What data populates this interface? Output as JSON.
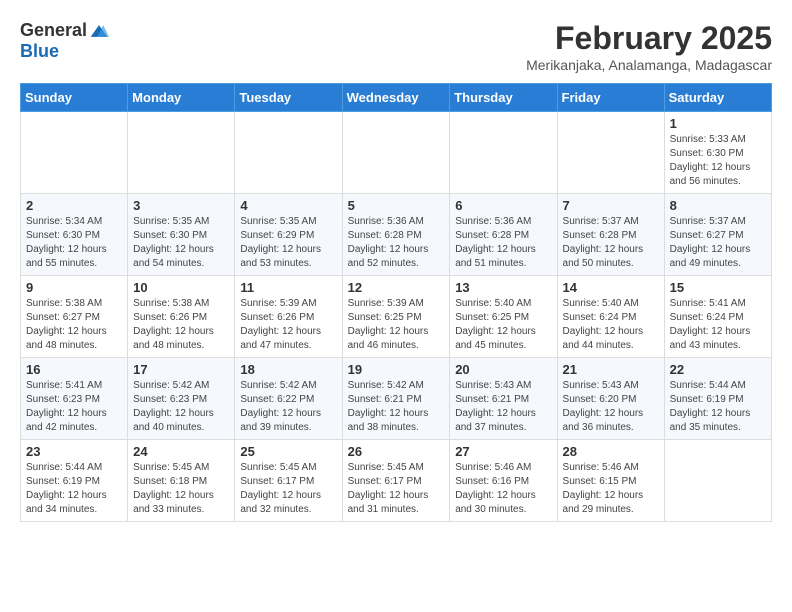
{
  "header": {
    "logo_general": "General",
    "logo_blue": "Blue",
    "month_title": "February 2025",
    "location": "Merikanjaka, Analamanga, Madagascar"
  },
  "weekdays": [
    "Sunday",
    "Monday",
    "Tuesday",
    "Wednesday",
    "Thursday",
    "Friday",
    "Saturday"
  ],
  "weeks": [
    [
      {
        "day": "",
        "info": ""
      },
      {
        "day": "",
        "info": ""
      },
      {
        "day": "",
        "info": ""
      },
      {
        "day": "",
        "info": ""
      },
      {
        "day": "",
        "info": ""
      },
      {
        "day": "",
        "info": ""
      },
      {
        "day": "1",
        "info": "Sunrise: 5:33 AM\nSunset: 6:30 PM\nDaylight: 12 hours and 56 minutes."
      }
    ],
    [
      {
        "day": "2",
        "info": "Sunrise: 5:34 AM\nSunset: 6:30 PM\nDaylight: 12 hours and 55 minutes."
      },
      {
        "day": "3",
        "info": "Sunrise: 5:35 AM\nSunset: 6:30 PM\nDaylight: 12 hours and 54 minutes."
      },
      {
        "day": "4",
        "info": "Sunrise: 5:35 AM\nSunset: 6:29 PM\nDaylight: 12 hours and 53 minutes."
      },
      {
        "day": "5",
        "info": "Sunrise: 5:36 AM\nSunset: 6:28 PM\nDaylight: 12 hours and 52 minutes."
      },
      {
        "day": "6",
        "info": "Sunrise: 5:36 AM\nSunset: 6:28 PM\nDaylight: 12 hours and 51 minutes."
      },
      {
        "day": "7",
        "info": "Sunrise: 5:37 AM\nSunset: 6:28 PM\nDaylight: 12 hours and 50 minutes."
      },
      {
        "day": "8",
        "info": "Sunrise: 5:37 AM\nSunset: 6:27 PM\nDaylight: 12 hours and 49 minutes."
      }
    ],
    [
      {
        "day": "9",
        "info": "Sunrise: 5:38 AM\nSunset: 6:27 PM\nDaylight: 12 hours and 48 minutes."
      },
      {
        "day": "10",
        "info": "Sunrise: 5:38 AM\nSunset: 6:26 PM\nDaylight: 12 hours and 48 minutes."
      },
      {
        "day": "11",
        "info": "Sunrise: 5:39 AM\nSunset: 6:26 PM\nDaylight: 12 hours and 47 minutes."
      },
      {
        "day": "12",
        "info": "Sunrise: 5:39 AM\nSunset: 6:25 PM\nDaylight: 12 hours and 46 minutes."
      },
      {
        "day": "13",
        "info": "Sunrise: 5:40 AM\nSunset: 6:25 PM\nDaylight: 12 hours and 45 minutes."
      },
      {
        "day": "14",
        "info": "Sunrise: 5:40 AM\nSunset: 6:24 PM\nDaylight: 12 hours and 44 minutes."
      },
      {
        "day": "15",
        "info": "Sunrise: 5:41 AM\nSunset: 6:24 PM\nDaylight: 12 hours and 43 minutes."
      }
    ],
    [
      {
        "day": "16",
        "info": "Sunrise: 5:41 AM\nSunset: 6:23 PM\nDaylight: 12 hours and 42 minutes."
      },
      {
        "day": "17",
        "info": "Sunrise: 5:42 AM\nSunset: 6:23 PM\nDaylight: 12 hours and 40 minutes."
      },
      {
        "day": "18",
        "info": "Sunrise: 5:42 AM\nSunset: 6:22 PM\nDaylight: 12 hours and 39 minutes."
      },
      {
        "day": "19",
        "info": "Sunrise: 5:42 AM\nSunset: 6:21 PM\nDaylight: 12 hours and 38 minutes."
      },
      {
        "day": "20",
        "info": "Sunrise: 5:43 AM\nSunset: 6:21 PM\nDaylight: 12 hours and 37 minutes."
      },
      {
        "day": "21",
        "info": "Sunrise: 5:43 AM\nSunset: 6:20 PM\nDaylight: 12 hours and 36 minutes."
      },
      {
        "day": "22",
        "info": "Sunrise: 5:44 AM\nSunset: 6:19 PM\nDaylight: 12 hours and 35 minutes."
      }
    ],
    [
      {
        "day": "23",
        "info": "Sunrise: 5:44 AM\nSunset: 6:19 PM\nDaylight: 12 hours and 34 minutes."
      },
      {
        "day": "24",
        "info": "Sunrise: 5:45 AM\nSunset: 6:18 PM\nDaylight: 12 hours and 33 minutes."
      },
      {
        "day": "25",
        "info": "Sunrise: 5:45 AM\nSunset: 6:17 PM\nDaylight: 12 hours and 32 minutes."
      },
      {
        "day": "26",
        "info": "Sunrise: 5:45 AM\nSunset: 6:17 PM\nDaylight: 12 hours and 31 minutes."
      },
      {
        "day": "27",
        "info": "Sunrise: 5:46 AM\nSunset: 6:16 PM\nDaylight: 12 hours and 30 minutes."
      },
      {
        "day": "28",
        "info": "Sunrise: 5:46 AM\nSunset: 6:15 PM\nDaylight: 12 hours and 29 minutes."
      },
      {
        "day": "",
        "info": ""
      }
    ]
  ]
}
